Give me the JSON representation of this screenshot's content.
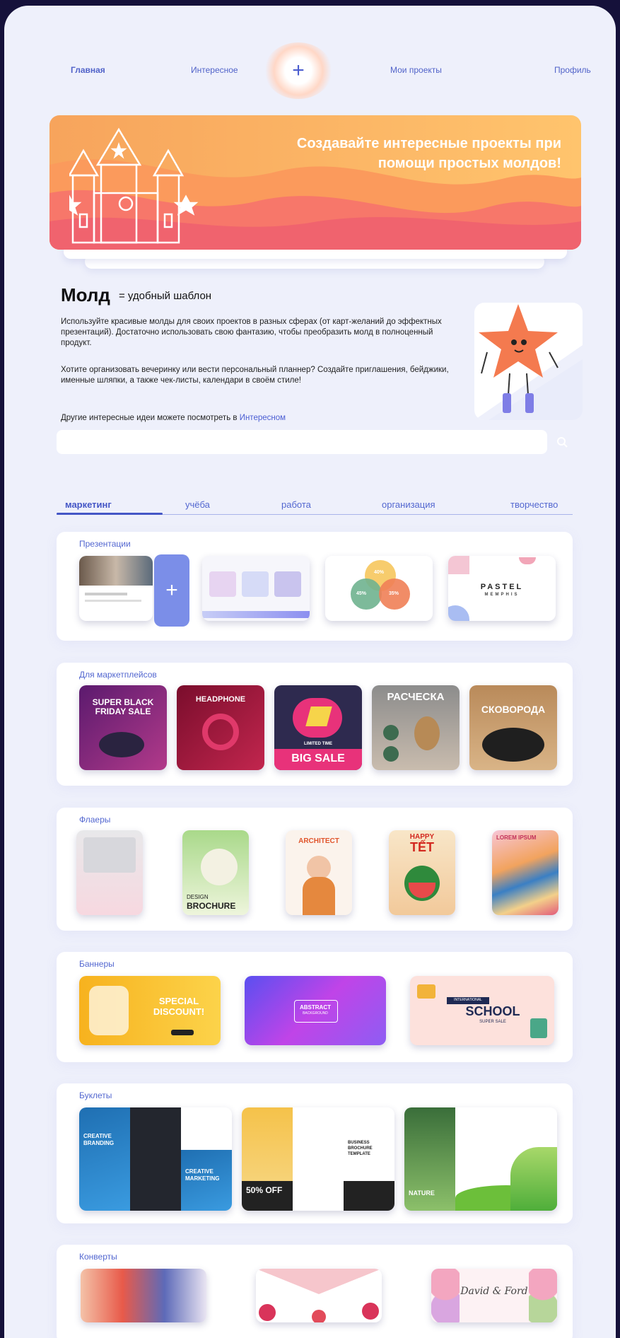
{
  "nav": {
    "home": "Главная",
    "interesting": "Интересное",
    "add": "+",
    "projects": "Мои проекты",
    "profile": "Профиль"
  },
  "hero": {
    "text": "Создавайте интересные проекты при помощи простых молдов!"
  },
  "intro": {
    "title": "Молд",
    "subtitle": "= удобный шаблон",
    "p1": "Используйте красивые молды для своих проектов в разных сферах (от карт-желаний до эффектных презентаций). Достаточно использовать свою фантазию, чтобы преобразить молд в полноценный продукт.",
    "p2": "Хотите организовать вечеринку или вести персональный планнер? Создайте приглашения, бейджики, именные шляпки, а также чек-листы, календари   в своём стиле!",
    "p3_prefix": "Другие интересные идеи можете посмотреть в ",
    "p3_link": "Интересном"
  },
  "search": {
    "placeholder": ""
  },
  "tabs": [
    "маркетинг",
    "учёба",
    "работа",
    "организация",
    "творчество"
  ],
  "sections": {
    "presentations": "Презентации",
    "marketplaces": "Для маркетплейсов",
    "flyers": "Флаеры",
    "banners": "Баннеры",
    "booklets": "Буклеты",
    "envelopes": "Конверты"
  },
  "thumbs": {
    "pastel": "PASTEL",
    "pastel_sub": "MEMPHIS",
    "venn_a": "40%",
    "venn_b": "45%",
    "venn_c": "35%",
    "mp1": "SUPER BLACK FRIDAY SALE",
    "mp2": "HEADPHONE",
    "mp3_small": "LIMITED TIME",
    "mp3": "BIG SALE",
    "mp4": "РАСЧЕСКА",
    "mp5": "СКОВОРОДА",
    "fl2_small": "DESIGN",
    "fl2": "BROCHURE",
    "fl3": "ARCHITECT",
    "fl4_small": "HAPPY",
    "fl4": "TẾT",
    "fl5": "LOREM IPSUM",
    "bn1": "SPECIAL DISCOUNT!",
    "bn2": "ABSTRACT",
    "bn2_sub": "BACKGROUND",
    "bn3_small": "INTERNATIONAL",
    "bn3": "SCHOOL",
    "bn3_sub": "SUPER SALE",
    "bk1": "CREATIVE BRANDING",
    "bk1_b": "CREATIVE MARKETING",
    "bk2": "50% OFF",
    "bk2_b": "BUSINESS BROCHURE TEMPLATE",
    "bk3": "NATURE",
    "env3": "David & Ford"
  },
  "colors": {
    "accent": "#4456c6",
    "background": "#eef0fb",
    "hero_orange": "#f7a45c",
    "hero_red": "#f26a6e"
  }
}
